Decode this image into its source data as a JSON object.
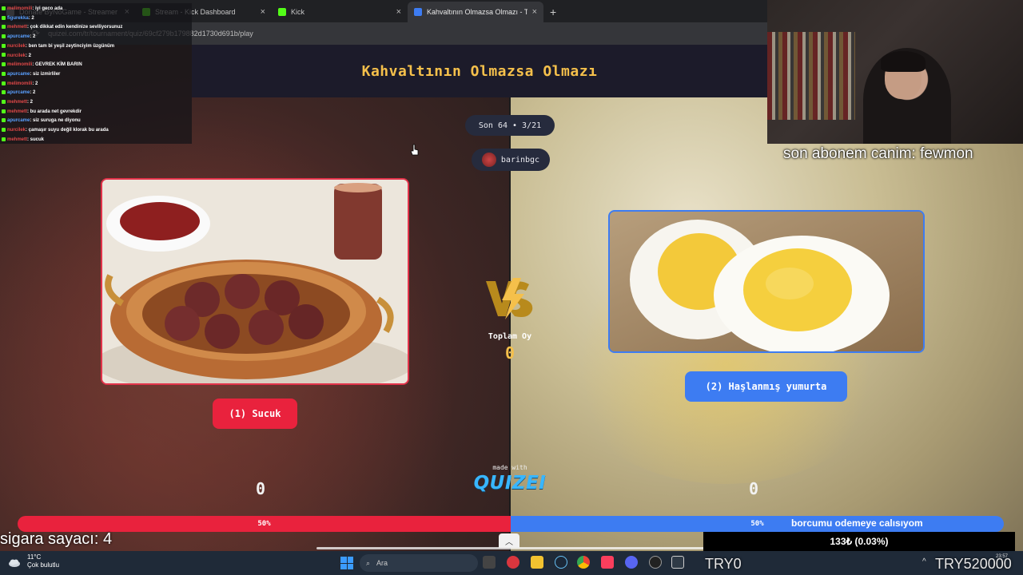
{
  "browser": {
    "tabs": [
      {
        "title": "Donate ByNoGame - Streamer",
        "color": "#8a8a8a",
        "active": false
      },
      {
        "title": "Stream - Kick Dashboard",
        "color": "#53fc18",
        "active": false
      },
      {
        "title": "Kick",
        "color": "#53fc18",
        "active": false
      },
      {
        "title": "Kahvaltının Olmazsa Olmazı - Tu",
        "color": "#3d7cf2",
        "active": true
      }
    ],
    "new_tab": "+",
    "close_glyph": "×",
    "url": "quizei.com/tr/tournament/quiz/69cf279b179882d1730d691b/play"
  },
  "quiz": {
    "title": "Kahvaltının Olmazsa Olmazı",
    "round": "Son 64 • 3/21",
    "user": "barinbgc",
    "option_left": {
      "label": "(1) Sucuk",
      "votes": "0",
      "percent_label": "50%",
      "share": 0.5
    },
    "option_right": {
      "label": "(2) Haşlanmış yumurta",
      "votes": "0",
      "percent_label": "50%",
      "share": 0.5
    },
    "vs": "VS",
    "total_label": "Toplam Oy",
    "total_value": "0",
    "made_with": "made with",
    "brand": "QUIZEI",
    "colors": {
      "left": "#e9223d",
      "right": "#3d7cf2",
      "accent": "#f5c04b"
    }
  },
  "chat": [
    {
      "user": "melimomili",
      "msg": ": iyi geco ada",
      "blue": false
    },
    {
      "user": "figurekka",
      "msg": ": 2",
      "blue": true
    },
    {
      "user": "mehmett",
      "msg": ": çok dikkat edin kendinize seviliyorsunuz",
      "blue": false
    },
    {
      "user": "apurcame",
      "msg": ": 2",
      "blue": true
    },
    {
      "user": "nurcilek",
      "msg": ": ben tam bi yeşil zeytinciyim üzgünüm",
      "blue": false
    },
    {
      "user": "nurcilek",
      "msg": ": 2",
      "blue": false
    },
    {
      "user": "melimomili",
      "msg": ": GEVREK KİM BARIN",
      "blue": false
    },
    {
      "user": "apurcame",
      "msg": ": siz izmirliler",
      "blue": true
    },
    {
      "user": "melimomili",
      "msg": ": 2",
      "blue": false
    },
    {
      "user": "apurcame",
      "msg": ": 2",
      "blue": true
    },
    {
      "user": "mehmett",
      "msg": ": 2",
      "blue": false
    },
    {
      "user": "mehmett",
      "msg": ": bu arada net gevrekdir",
      "blue": false
    },
    {
      "user": "apurcame",
      "msg": ": siz suruga ne diyonu",
      "blue": true
    },
    {
      "user": "nurcilek",
      "msg": ": çamaşır suyu değil klorak bu arada",
      "blue": false
    },
    {
      "user": "mehmett",
      "msg": ": sucuk",
      "blue": false
    }
  ],
  "overlays": {
    "last_sub": "son abonem canim: fewmon",
    "smoke_counter": "sigara sayacı: 4",
    "goal_title": "borcumu odemeye calısıyom",
    "goal_value": "133₺ (0.03%)",
    "currency_left": "TRY0",
    "currency_right": "TRY520000"
  },
  "taskbar": {
    "temperature": "11°C",
    "weather": "Çok bulutlu",
    "search_placeholder": "Ara",
    "time": "23:57",
    "icon_names": [
      "start-icon",
      "search-icon",
      "task-view-icon",
      "file-explorer-icon",
      "steam-icon",
      "chrome-icon",
      "music-icon",
      "discord-icon",
      "obs-icon",
      "app-icon"
    ]
  }
}
